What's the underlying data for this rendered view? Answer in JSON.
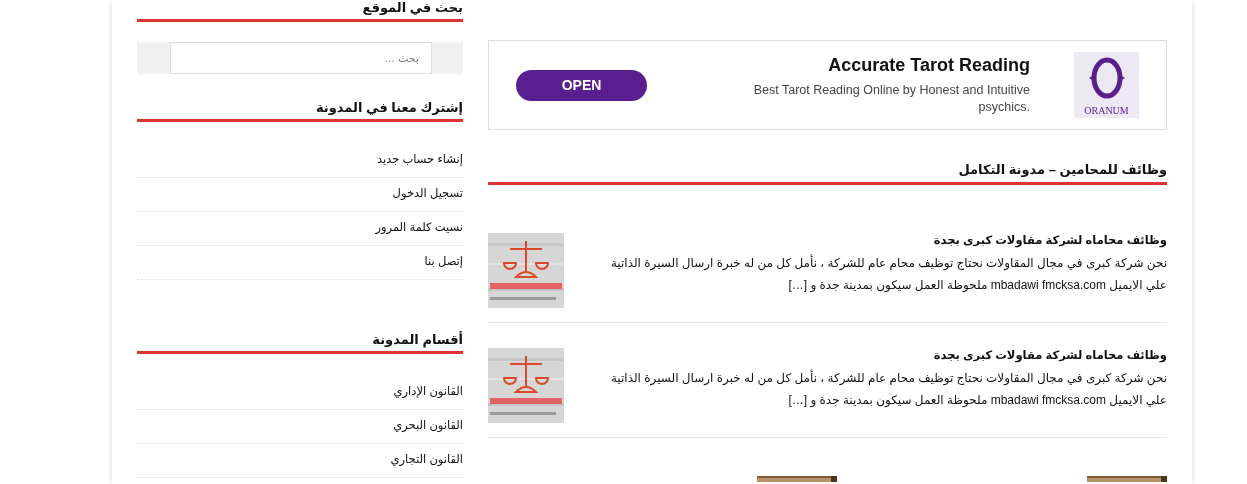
{
  "sidebar": {
    "search_widget": {
      "title": "بحث في الموقع",
      "placeholder": "بحث …"
    },
    "widgets": [
      {
        "title": "إشترك معنا في المدونة",
        "items": [
          "إنشاء حساب جديد",
          "تسجيل الدخول",
          "نسيت كلمة المرور",
          "إتصل بنا"
        ]
      },
      {
        "title": "أقسام المدونة",
        "items": [
          "القانون الإداري",
          "القانون البحري",
          "القانون التجاري"
        ]
      }
    ]
  },
  "ad": {
    "title": "Accurate Tarot Reading",
    "description": "Best Tarot Reading Online by Honest and Intuitive psychics.",
    "button": "OPEN",
    "logo_text": "ORANUM"
  },
  "section": {
    "title": "وظائف للمحامين – مدونة التكامل"
  },
  "posts": [
    {
      "title": "وظائف محاماه لشركة مقاولات كبرى بجدة",
      "excerpt": "نحن شركة كبرى في مجال المقاولات نحتاج توظيف محام عام للشركة ، نأمل كل من له خبرة ارسال السيرة الذاتية علي الايميل mbadawi fmcksa.com ملحوظة العمل سيكون بمدينة جدة و […]"
    },
    {
      "title": "وظائف محاماه لشركة مقاولات كبرى بجدة",
      "excerpt": "نحن شركة كبرى في مجال المقاولات نحتاج توظيف محام عام للشركة ، نأمل كل من له خبرة ارسال السيرة الذاتية علي الايميل mbadawi fmcksa.com ملحوظة العمل سيكون بمدينة جدة و […]"
    }
  ]
}
